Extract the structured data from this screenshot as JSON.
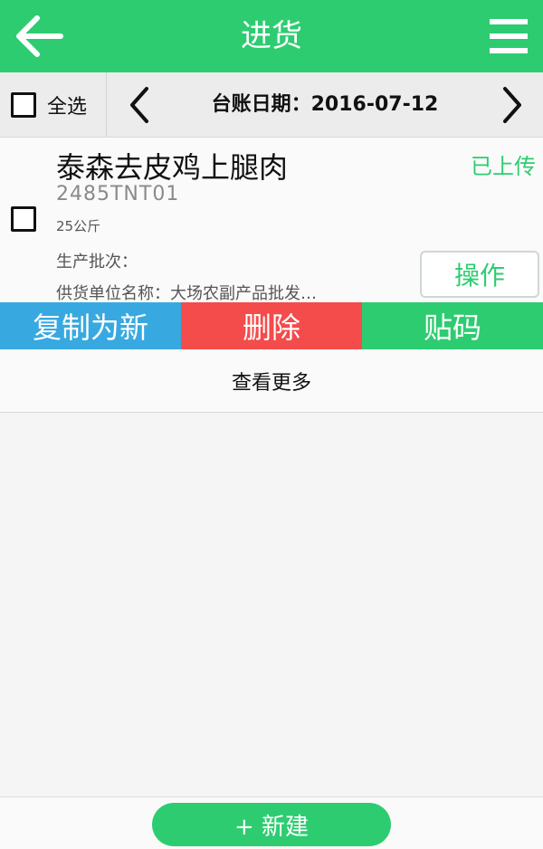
{
  "header": {
    "title": "进货",
    "back_icon": "arrow-left-icon",
    "menu_icon": "hamburger-menu-icon"
  },
  "datebar": {
    "select_all_label": "全选",
    "date_text": "台账日期：2016-07-12",
    "prev_icon": "chevron-left-icon",
    "next_icon": "chevron-right-icon"
  },
  "items": [
    {
      "name": "泰森去皮鸡上腿肉",
      "status": "已上传",
      "code": "2485TNT01",
      "weight": "25公斤",
      "batch_label": "生产批次：",
      "supplier_text": "供货单位名称：大场农副产品批发…",
      "operate_label": "操作",
      "actions": {
        "copy_label": "复制为新",
        "delete_label": "删除",
        "barcode_label": "贴码"
      }
    }
  ],
  "more_label": "查看更多",
  "footer": {
    "new_label": "+ 新建"
  },
  "colors": {
    "primary_green": "#2ecc71",
    "copy_blue": "#38a9e0",
    "delete_red": "#f44b4b"
  }
}
